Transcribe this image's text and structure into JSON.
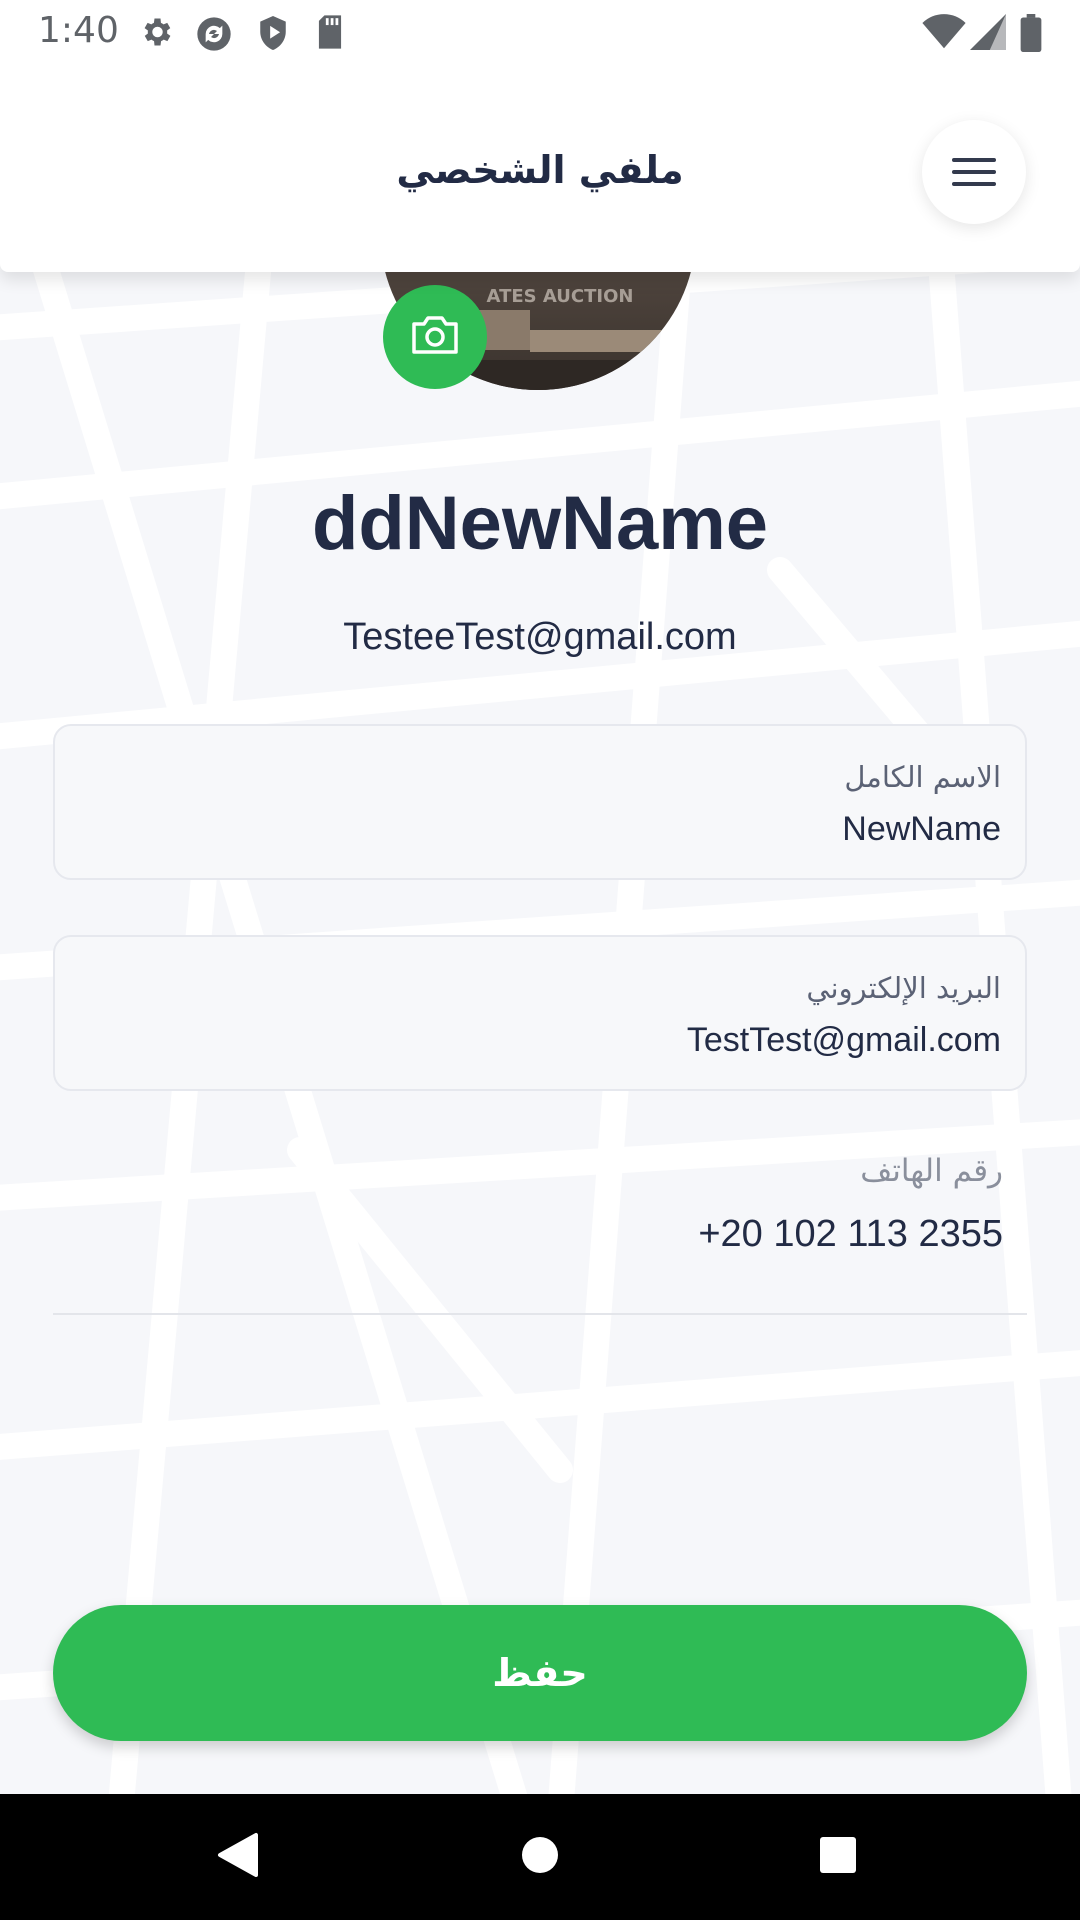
{
  "status_bar": {
    "time": "1:40",
    "icons_left": [
      "gear-icon",
      "sync-icon",
      "shield-play-icon",
      "sd-card-icon"
    ],
    "icons_right": [
      "wifi-icon",
      "signal-icon",
      "battery-icon"
    ]
  },
  "header": {
    "title": "ملفي الشخصي",
    "menu_icon": "hamburger-menu-icon"
  },
  "avatar": {
    "watermark": "ATES AUCTION",
    "camera_icon": "camera-icon"
  },
  "profile": {
    "display_name": "ddNewName",
    "display_email": "TesteeTest@gmail.com"
  },
  "form": {
    "full_name": {
      "label": "الاسم الكامل",
      "value": "NewName"
    },
    "email": {
      "label": "البريد الإلكتروني",
      "value": "TestTest@gmail.com"
    },
    "phone": {
      "label": "رقم الهاتف",
      "value": "+20 102 113 2355"
    }
  },
  "save_button": {
    "label": "حفظ"
  },
  "nav_bar": {
    "icons": [
      "back-icon",
      "home-icon",
      "recents-icon"
    ]
  },
  "colors": {
    "accent": "#2fbb55",
    "text_primary": "#222b45",
    "background": "#f8f9fb"
  }
}
